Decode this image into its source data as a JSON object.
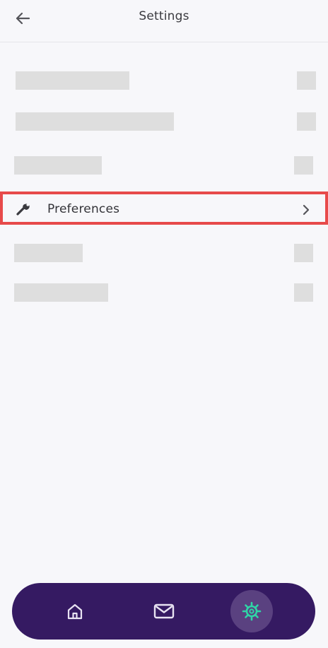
{
  "header": {
    "title": "Settings",
    "back_icon": "arrow-left-icon"
  },
  "settings": {
    "preferences": {
      "label": "Preferences",
      "icon": "wrench-icon",
      "chevron": "chevron-right-icon"
    }
  },
  "tabbar": {
    "tabs": [
      {
        "icon": "home-icon",
        "active": false
      },
      {
        "icon": "mail-icon",
        "active": false
      },
      {
        "icon": "gear-icon",
        "active": true
      }
    ]
  },
  "colors": {
    "background": "#f7f7fa",
    "tabbar": "#351a62",
    "active_tab": "#5a4180",
    "active_icon": "#2fd5a6",
    "highlight_border": "#e74a4a"
  }
}
